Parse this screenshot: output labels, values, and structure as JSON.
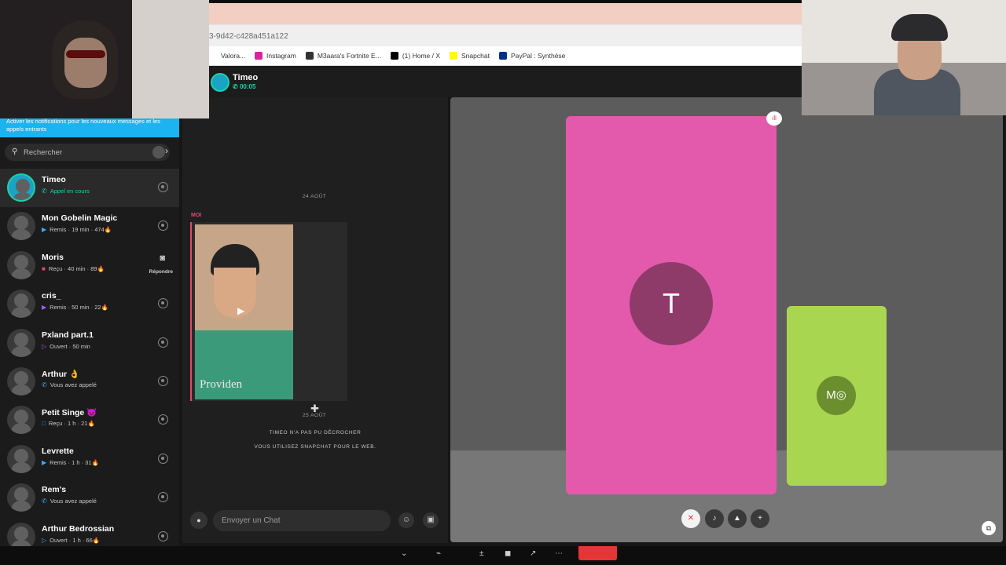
{
  "browser": {
    "url_fragment": "3-9d42-c428a451a122",
    "bookmarks": [
      {
        "label": "Valora...",
        "icon": "bookmark-icon",
        "color": "#ffffff"
      },
      {
        "label": "Instagram",
        "icon": "instagram-icon",
        "color": "#d6249f"
      },
      {
        "label": "M3aara's Fortnite E...",
        "icon": "fortnite-icon",
        "color": "#333333"
      },
      {
        "label": "(1) Home / X",
        "icon": "x-icon",
        "color": "#000000"
      },
      {
        "label": "Snapchat",
        "icon": "snapchat-icon",
        "color": "#fffc00"
      },
      {
        "label": "PayPal : Synthèse",
        "icon": "paypal-icon",
        "color": "#003087"
      }
    ]
  },
  "call": {
    "name": "Timeo",
    "duration": "00:05"
  },
  "sidebar": {
    "notification": "Activer les notifications pour les nouveaux messages et les appels entrants",
    "search_placeholder": "Rechercher",
    "conversations": [
      {
        "name": "Timeo",
        "status": "Appel en cours",
        "status_icon": "phone-icon",
        "status_color": "#21d0a7",
        "active": true
      },
      {
        "name": "Mon Gobelin Magic",
        "status": "Remis · 19 min · 474🔥",
        "status_icon": "sent-arrow-icon",
        "status_color": "#3fa9f5"
      },
      {
        "name": "Moris",
        "status": "Reçu · 40 min · 89🔥",
        "status_icon": "received-square-icon",
        "status_color": "#e24a6b",
        "reply": "Répondre"
      },
      {
        "name": "cris_",
        "status": "Remis · 50 min · 22🔥",
        "status_icon": "sent-arrow-icon",
        "status_color": "#a05cff"
      },
      {
        "name": "Pxland part.1",
        "status": "Ouvert · 50 min",
        "status_icon": "opened-arrow-icon",
        "status_color": "#a05cff"
      },
      {
        "name": "Arthur 👌",
        "status": "Vous avez appelé",
        "status_icon": "phone-icon",
        "status_color": "#3fa9f5"
      },
      {
        "name": "Petit Singe 😈",
        "status": "Reçu · 1 h · 21🔥",
        "status_icon": "chat-square-icon",
        "status_color": "#3fa9f5"
      },
      {
        "name": "Levrette",
        "status": "Remis · 1 h · 31🔥",
        "status_icon": "sent-arrow-icon",
        "status_color": "#3fa9f5"
      },
      {
        "name": "Rem's",
        "status": "Vous avez appelé",
        "status_icon": "phone-icon",
        "status_color": "#3fa9f5"
      },
      {
        "name": "Arthur Bedrossian",
        "status": "Ouvert · 1 h · 66🔥",
        "status_icon": "opened-arrow-icon",
        "status_color": "#3fa9f5"
      }
    ]
  },
  "chat": {
    "date1": "24 AOÛT",
    "sender": "MOI",
    "snap_caption": "Providen",
    "date2": "25 AOÛT",
    "system1": "TIMEO N'A PAS PU DÉCROCHER",
    "system2": "VOUS UTILISEZ SNAPCHAT POUR LE WEB.",
    "composer_placeholder": "Envoyer un Chat"
  },
  "video": {
    "tile1_initial": "T",
    "tile1_color": "#e35aad",
    "tile2_initial": "M",
    "tile2_color": "#a9d650"
  }
}
